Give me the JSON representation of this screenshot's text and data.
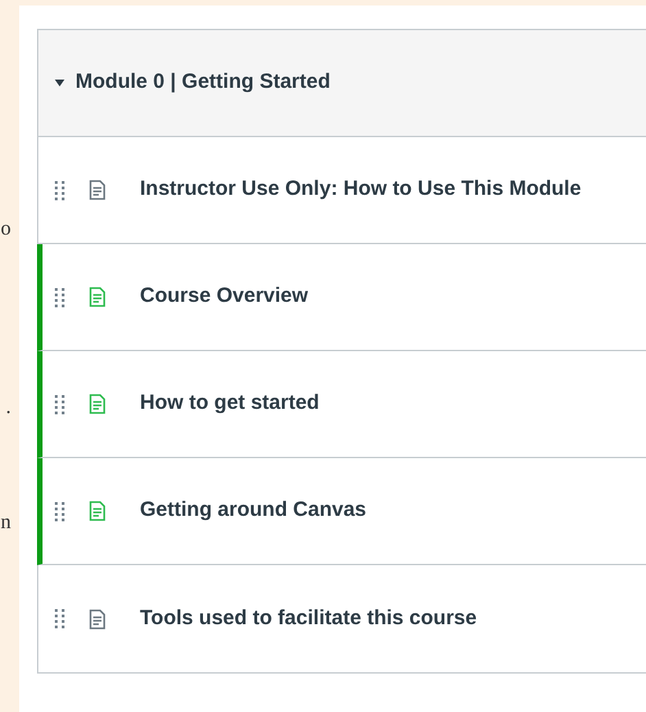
{
  "side_fragments": [
    {
      "text": "o"
    },
    {
      "text": "."
    },
    {
      "text": "n"
    }
  ],
  "module": {
    "title": "Module 0 | Getting Started",
    "expanded": true,
    "items": [
      {
        "title": "Instructor Use Only: How to Use This Module",
        "published": false
      },
      {
        "title": "Course Overview",
        "published": true
      },
      {
        "title": "How to get started",
        "published": true
      },
      {
        "title": "Getting around Canvas",
        "published": true
      },
      {
        "title": "Tools used to facilitate this course",
        "published": false
      }
    ]
  }
}
